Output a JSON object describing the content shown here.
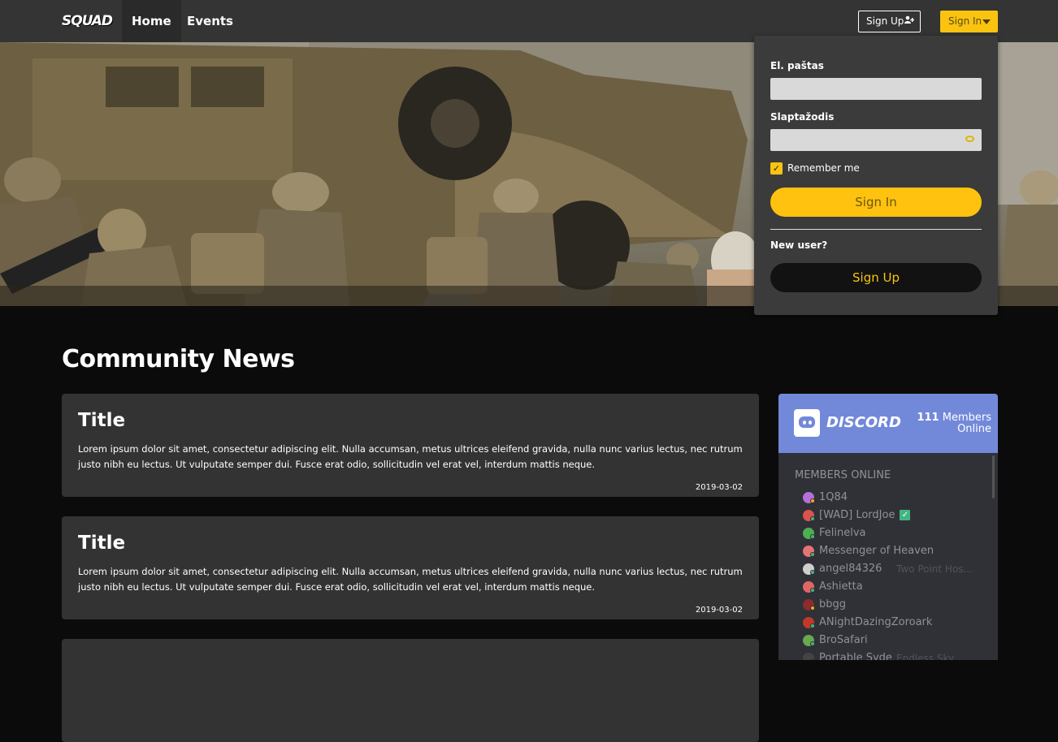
{
  "nav": {
    "logo_text": "SQUAD",
    "items": [
      {
        "label": "Home"
      },
      {
        "label": "Events"
      }
    ],
    "signup_label": "Sign Up",
    "signin_label": "Sign In"
  },
  "login": {
    "email_label": "El. paštas",
    "email_value": "",
    "password_label": "Slaptažodis",
    "password_value": "",
    "remember_label": "Remember me",
    "remember_checked": true,
    "signin_button": "Sign In",
    "new_user_label": "New user?",
    "signup_button": "Sign Up"
  },
  "main": {
    "section_title": "Community News",
    "news": [
      {
        "title": "Title",
        "body": "Lorem ipsum dolor sit amet, consectetur adipiscing elit. Nulla accumsan, metus ultrices eleifend gravida, nulla nunc varius lectus, nec rutrum justo nibh eu lectus. Ut vulputate semper dui. Fusce erat odio, sollicitudin vel erat vel, interdum mattis neque.",
        "date": "2019-03-02"
      },
      {
        "title": "Title",
        "body": "Lorem ipsum dolor sit amet, consectetur adipiscing elit. Nulla accumsan, metus ultrices eleifend gravida, nulla nunc varius lectus, nec rutrum justo nibh eu lectus. Ut vulputate semper dui. Fusce erat odio, sollicitudin vel erat vel, interdum mattis neque.",
        "date": "2019-03-02"
      }
    ]
  },
  "discord": {
    "wordmark": "DISCORD",
    "members_count": "111",
    "members_label_1": "Members",
    "members_label_2": "Online",
    "members_heading": "MEMBERS ONLINE",
    "members": [
      {
        "name": "1Q84",
        "game": "",
        "verified": false,
        "avatar": "#b46fd8",
        "status": "#faa61a"
      },
      {
        "name": "[WAD] LordJoe",
        "game": "",
        "verified": true,
        "avatar": "#d9534f",
        "status": "#43b581"
      },
      {
        "name": "Felinelva",
        "game": "",
        "verified": false,
        "avatar": "#4caf50",
        "status": "#43b581"
      },
      {
        "name": "Messenger of Heaven",
        "game": "",
        "verified": false,
        "avatar": "#e57373",
        "status": "#43b581"
      },
      {
        "name": "angel84326",
        "game": "Two Point Hos...",
        "verified": false,
        "avatar": "#cfcfcf",
        "status": "#43b581"
      },
      {
        "name": "Ashietta",
        "game": "",
        "verified": false,
        "avatar": "#e06666",
        "status": "#43b581"
      },
      {
        "name": "bbgg",
        "game": "",
        "verified": false,
        "avatar": "#8b2d2d",
        "status": "#faa61a"
      },
      {
        "name": "ANightDazingZoroark",
        "game": "",
        "verified": false,
        "avatar": "#c0392b",
        "status": "#43b581"
      },
      {
        "name": "BroSafari",
        "game": "",
        "verified": false,
        "avatar": "#6aa84f",
        "status": "#43b581"
      },
      {
        "name": "Portable Syde",
        "game": "Endless Sky",
        "verified": false,
        "avatar": "#444444",
        "status": "#43b581"
      }
    ]
  },
  "colors": {
    "accent": "#f9c310",
    "discord": "#7289da",
    "navbar": "#343434",
    "card": "#333333"
  }
}
